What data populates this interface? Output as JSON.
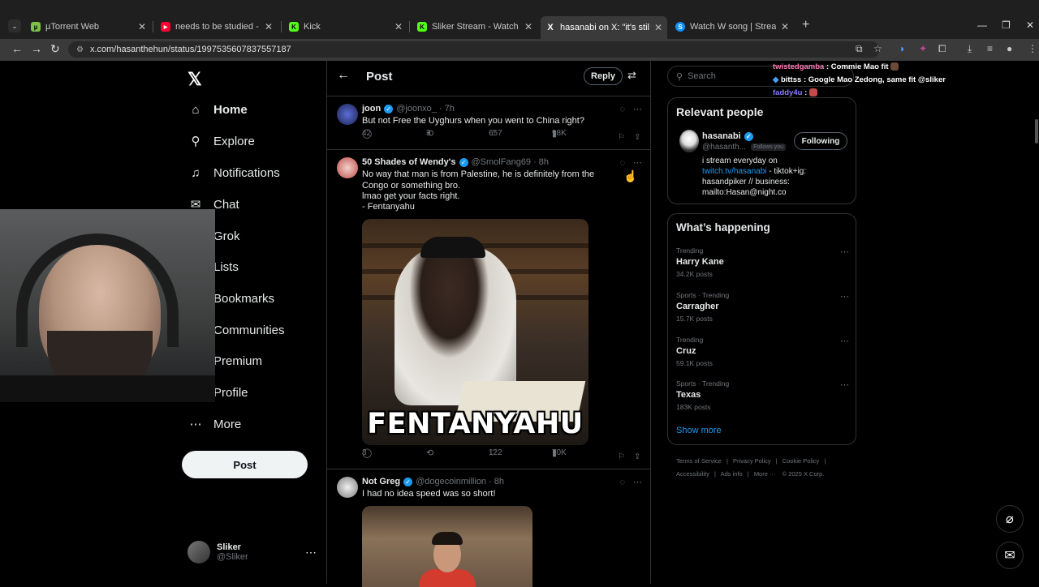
{
  "browser": {
    "tabs": [
      {
        "title": "µTorrent Web",
        "color": "#7dc242",
        "glyph": "µ"
      },
      {
        "title": "needs to be studied - YouT",
        "color": "#ff0033",
        "glyph": "▶"
      },
      {
        "title": "Kick",
        "color": "#53fc18",
        "glyph": "K"
      },
      {
        "title": "Sliker Stream - Watch Live c",
        "color": "#53fc18",
        "glyph": "K"
      },
      {
        "title": "hasanabi on X: \"it's still free pal",
        "color": "#ffffff",
        "glyph": "X"
      },
      {
        "title": "Watch W song | Streamable",
        "color": "#0f90fa",
        "glyph": "S"
      }
    ],
    "url": "x.com/hasanthehun/status/1997535607837557187"
  },
  "nav": {
    "logo": "𝕏",
    "items": [
      {
        "label": "Home",
        "icon": "⌂"
      },
      {
        "label": "Explore",
        "icon": "⚲"
      },
      {
        "label": "Notifications",
        "icon": "🔔"
      },
      {
        "label": "Chat",
        "icon": "✉"
      },
      {
        "label": "Grok",
        "icon": "◩"
      },
      {
        "label": "Lists",
        "icon": "☰"
      },
      {
        "label": "Bookmarks",
        "icon": "⚑"
      },
      {
        "label": "Communities",
        "icon": "⚇"
      },
      {
        "label": "Premium",
        "icon": "✕"
      },
      {
        "label": "Profile",
        "icon": "☺"
      },
      {
        "label": "More",
        "icon": "⋯"
      }
    ],
    "post_label": "Post",
    "account": {
      "name": "Sliker",
      "handle": "@Sliker"
    }
  },
  "header": {
    "title": "Post",
    "reply_label": "Reply"
  },
  "tweets": [
    {
      "name": "joon",
      "handle": "@joonxo_",
      "time": "· 7h",
      "text": [
        "But not Free the Uyghurs when you went to China right?"
      ],
      "replies": "42",
      "reposts": "3",
      "likes": "657",
      "views": "98K"
    },
    {
      "name": "50 Shades of Wendy's",
      "handle": "@SmolFang69",
      "time": "· 8h",
      "text": [
        "No way that man is from Palestine, he is definitely from the Congo or something bro.",
        "lmao get your facts right.",
        "- Fentanyahu"
      ],
      "image_caption": "FENTANYAHU",
      "replies": "3",
      "reposts": "",
      "likes": "122",
      "views": "70K"
    },
    {
      "name": "Not Greg",
      "handle": "@dogecoinmillion",
      "time": "· 8h",
      "text": [
        "I had no idea speed was so short!"
      ]
    }
  ],
  "search": {
    "placeholder": "Search"
  },
  "chat": [
    {
      "user": "twistedgamba",
      "msg": ": Commie Mao fit",
      "color": "#ff7ab6"
    },
    {
      "user": "bittss",
      "msg": ": Google Mao Zedong, same fit @sliker",
      "color": "#ffffff"
    },
    {
      "user": "faddy4u",
      "msg": ":",
      "color": "#8a7cff"
    }
  ],
  "relevant": {
    "heading": "Relevant people",
    "name": "hasanabi",
    "handle": "@hasanth...",
    "follows_you": "Follows you",
    "follow_label": "Following",
    "bio_line1": "i stream everyday on",
    "bio_link": "twitch.tv/hasanabi",
    "bio_line2": " - tiktok+ig:",
    "bio_line3": "hasandpiker // business:",
    "bio_line4": "mailto:Hasan@night.co"
  },
  "happening": {
    "heading": "What’s happening",
    "trends": [
      {
        "meta": "Trending",
        "name": "Harry Kane",
        "count": "34.2K posts"
      },
      {
        "meta": "Sports · Trending",
        "name": "Carragher",
        "count": "15.7K posts"
      },
      {
        "meta": "Trending",
        "name": "Cruz",
        "count": "59.1K posts"
      },
      {
        "meta": "Sports · Trending",
        "name": "Texas",
        "count": "183K posts"
      }
    ],
    "show_more": "Show more"
  },
  "footer": {
    "line1": [
      "Terms of Service",
      "|",
      "Privacy Policy",
      "|",
      "Cookie Policy",
      "|"
    ],
    "line2": [
      "Accessibility",
      "|",
      "Ads info",
      "|",
      "More ···",
      "© 2025 X Corp."
    ]
  }
}
